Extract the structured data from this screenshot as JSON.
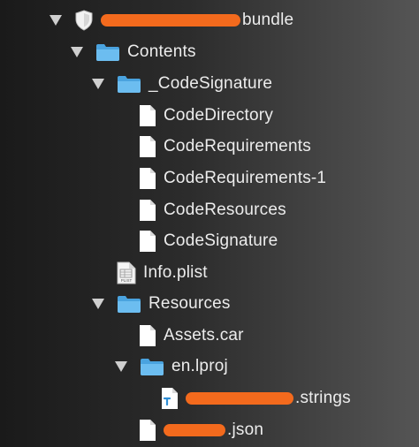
{
  "tree": {
    "root": {
      "label_suffix": "bundle",
      "icon": "bundle-shield-icon",
      "expanded": true
    },
    "contents": {
      "label": "Contents",
      "icon": "folder-icon",
      "expanded": true
    },
    "code_signature": {
      "label": "_CodeSignature",
      "icon": "folder-icon",
      "expanded": true
    },
    "code_directory": {
      "label": "CodeDirectory",
      "icon": "document-icon"
    },
    "code_requirements": {
      "label": "CodeRequirements",
      "icon": "document-icon"
    },
    "code_requirements_1": {
      "label": "CodeRequirements-1",
      "icon": "document-icon"
    },
    "code_resources": {
      "label": "CodeResources",
      "icon": "document-icon"
    },
    "code_signature_file": {
      "label": "CodeSignature",
      "icon": "document-icon"
    },
    "info_plist": {
      "label": "Info.plist",
      "icon": "plist-file-icon",
      "icon_text": "PLIST"
    },
    "resources": {
      "label": "Resources",
      "icon": "folder-icon",
      "expanded": true
    },
    "assets_car": {
      "label": "Assets.car",
      "icon": "document-icon"
    },
    "en_lproj": {
      "label": "en.lproj",
      "icon": "folder-icon",
      "expanded": true
    },
    "strings_file": {
      "label_suffix": ".strings",
      "icon": "strings-file-icon"
    },
    "json_file": {
      "label_suffix": ".json",
      "icon": "document-icon"
    }
  },
  "colors": {
    "folder": "#5fb3e8",
    "redaction": "#f36a1d",
    "text": "#ececec"
  }
}
